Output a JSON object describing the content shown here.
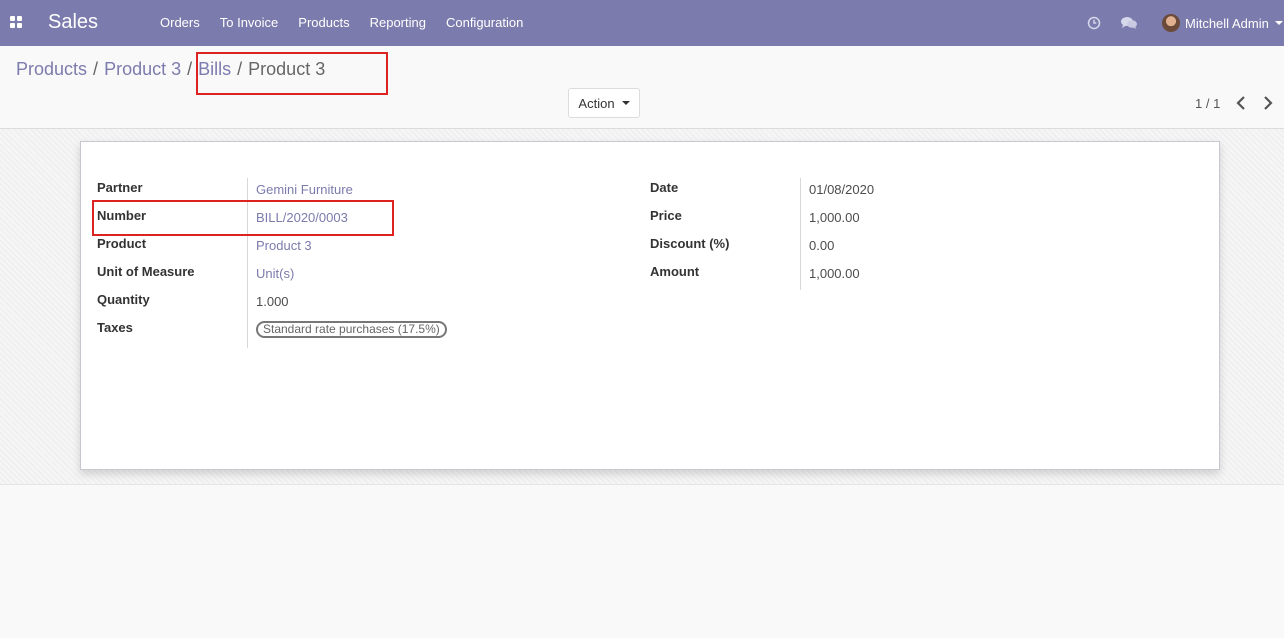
{
  "navbar": {
    "brand": "Sales",
    "menu": [
      "Orders",
      "To Invoice",
      "Products",
      "Reporting",
      "Configuration"
    ],
    "user_name": "Mitchell Admin",
    "icons": [
      "apps-grid-icon",
      "clock-icon",
      "chat-icon"
    ]
  },
  "breadcrumb": {
    "items": [
      "Products",
      "Product 3",
      "Bills"
    ],
    "current": "Product 3",
    "separator": "/"
  },
  "control_panel": {
    "action_label": "Action",
    "pager": "1 / 1"
  },
  "form": {
    "left": {
      "partner": {
        "label": "Partner",
        "value": "Gemini Furniture"
      },
      "number": {
        "label": "Number",
        "value": "BILL/2020/0003"
      },
      "product": {
        "label": "Product",
        "value": "Product 3"
      },
      "uom": {
        "label": "Unit of Measure",
        "value": "Unit(s)"
      },
      "quantity": {
        "label": "Quantity",
        "value": "1.000"
      },
      "taxes": {
        "label": "Taxes",
        "value": "Standard rate purchases (17.5%)"
      }
    },
    "right": {
      "date": {
        "label": "Date",
        "value": "01/08/2020"
      },
      "price": {
        "label": "Price",
        "value": "1,000.00"
      },
      "discount": {
        "label": "Discount (%)",
        "value": "0.00"
      },
      "amount": {
        "label": "Amount",
        "value": "1,000.00"
      }
    }
  },
  "colors": {
    "brand": "#7c7bad",
    "highlight": "#dd2222"
  }
}
